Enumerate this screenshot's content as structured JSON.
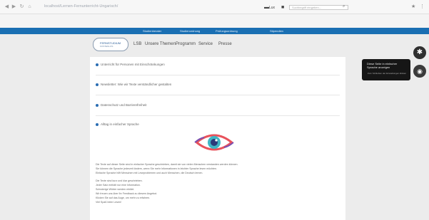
{
  "browser": {
    "url": "localhost/Lernen-Fernunterricht-Ungarisch/"
  },
  "util": {
    "lang": "Lux",
    "search_placeholder": "Suchbegriff eingeben..."
  },
  "bluebar": {
    "links": [
      "Studienberater",
      "Studienordnung",
      "Prüfungsordnung",
      "Stipendien"
    ]
  },
  "header": {
    "logo_line1": "FERNSTUDIUM",
    "logo_line2": "KOSTENLOS",
    "menu": [
      "LSB",
      "Unsere Themen",
      "Programm",
      "Service",
      "Presse"
    ]
  },
  "widget": {
    "tooltip_title": "Diese Seite in einfacher Sprache anzeigen",
    "tooltip_sub": "Zum Schließen der Einstellungen klicken"
  },
  "content": {
    "rows": [
      "Unterricht für Personen mit Einschränkungen",
      "Newsletter: Wie wir Texte verständlicher gestalten",
      "Datenschutz und Barrierefreiheit",
      "Alltag in einfacher Sprache"
    ],
    "paragraphs": [
      "Die Texte auf dieser Seite sind in einfacher Sprache geschrieben, damit sie von vielen Menschen verstanden werden können.",
      "Sie können die Sprache jederzeit ändern, wenn Sie mehr Informationen in leichter Sprache lesen möchten.",
      "Einfache Sprache hilft Menschen mit Leseproblemen und auch Menschen, die Deutsch lernen.",
      "Die Texte sind kurz und klar geschrieben.",
      "Jeder Satz enthält nur eine Information.",
      "Schwierige Wörter werden erklärt.",
      "Wir freuen uns über Ihr Feedback zu diesem Angebot.",
      "Klicken Sie auf das Auge, um mehr zu erfahren.",
      "Viel Spaß beim Lesen!"
    ]
  }
}
